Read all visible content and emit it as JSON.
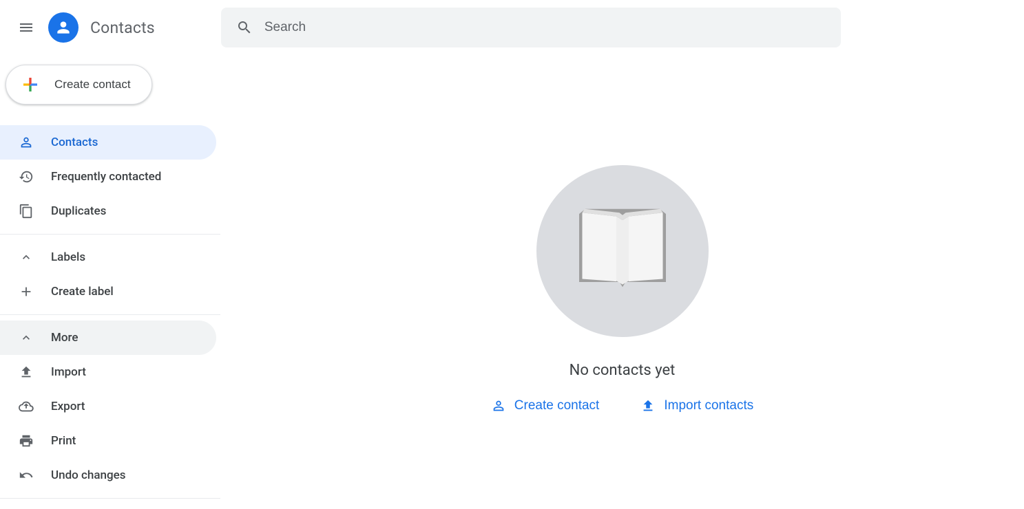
{
  "header": {
    "app_title": "Contacts",
    "search_placeholder": "Search"
  },
  "sidebar": {
    "create_label": "Create contact",
    "items": [
      {
        "label": "Contacts"
      },
      {
        "label": "Frequently contacted"
      },
      {
        "label": "Duplicates"
      }
    ],
    "labels_header": "Labels",
    "create_label_label": "Create label",
    "more_header": "More",
    "more_items": [
      {
        "label": "Import"
      },
      {
        "label": "Export"
      },
      {
        "label": "Print"
      },
      {
        "label": "Undo changes"
      }
    ]
  },
  "main": {
    "empty_message": "No contacts yet",
    "create_contact_label": "Create contact",
    "import_contacts_label": "Import contacts"
  }
}
